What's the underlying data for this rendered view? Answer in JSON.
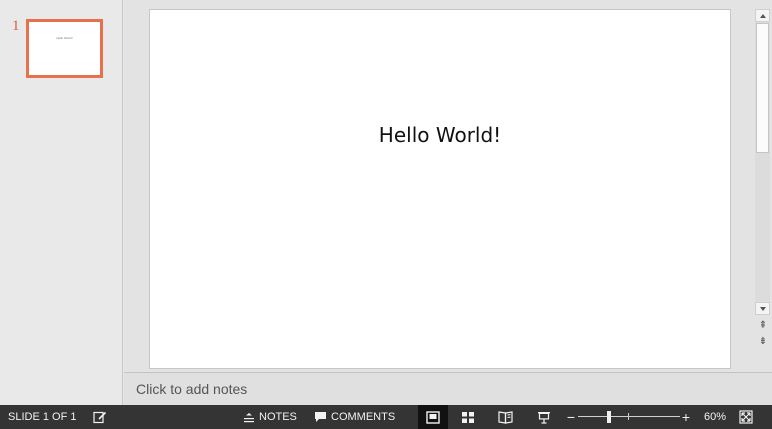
{
  "thumbnails": [
    {
      "number": "1",
      "title": "Hello World!"
    }
  ],
  "slide": {
    "title": "Hello World!"
  },
  "notes": {
    "placeholder": "Click to add notes"
  },
  "status_bar": {
    "slide_counter": "SLIDE 1 OF 1",
    "notes_label": "NOTES",
    "comments_label": "COMMENTS",
    "zoom_level": "60%",
    "zoom_fraction": 0.3
  },
  "colors": {
    "accent": "#e8704a",
    "status_bar_bg": "#343434"
  },
  "icons": {
    "spell_check": "spell-check-icon",
    "notes": "notes-icon",
    "comments": "comment-icon",
    "normal_view": "normal-view-icon",
    "slide_sorter": "slide-sorter-icon",
    "reading_view": "reading-view-icon",
    "slide_show": "slide-show-icon",
    "fit_slide": "fit-slide-icon"
  }
}
